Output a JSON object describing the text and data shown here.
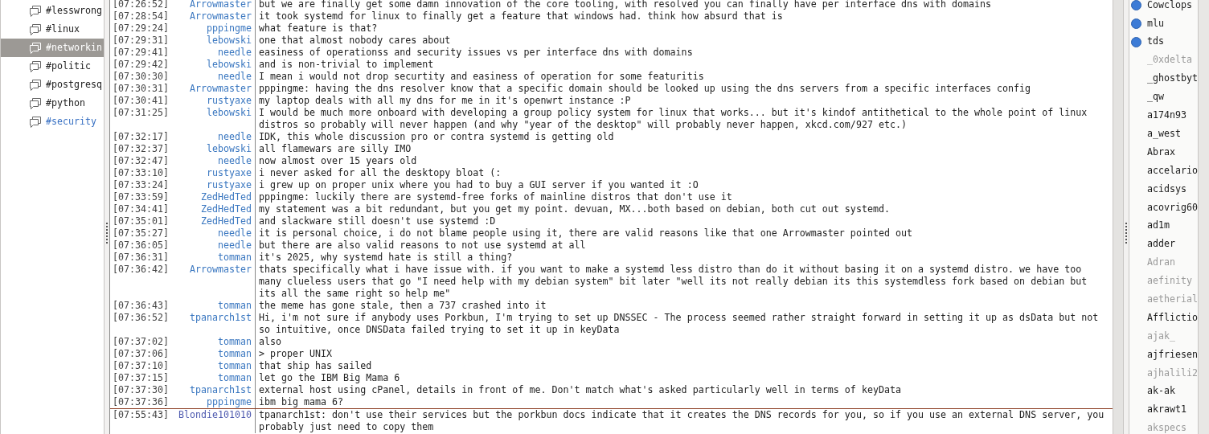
{
  "channels": [
    {
      "name": "#lesswrong",
      "selected": false,
      "new_activity": false
    },
    {
      "name": "#linux",
      "selected": false,
      "new_activity": false
    },
    {
      "name": "#networkin",
      "selected": true,
      "new_activity": false
    },
    {
      "name": "#politic",
      "selected": false,
      "new_activity": false
    },
    {
      "name": "#postgresq",
      "selected": false,
      "new_activity": false
    },
    {
      "name": "#python",
      "selected": false,
      "new_activity": false
    },
    {
      "name": "#security",
      "selected": false,
      "new_activity": true
    }
  ],
  "chat": {
    "messages": [
      {
        "time": "[07:26:52]",
        "nick": "Arrowmaster",
        "color": "#3a77c0",
        "text": "but we are finally get some damn innovation of the core tooling, with resolved you can finally have per interface dns with domains"
      },
      {
        "time": "[07:28:54]",
        "nick": "Arrowmaster",
        "color": "#3a77c0",
        "text": "it took systemd for linux to finally get a feature that windows had. think how absurd that is"
      },
      {
        "time": "[07:29:24]",
        "nick": "pppingme",
        "color": "#3a77c0",
        "text": "what feature is that?"
      },
      {
        "time": "[07:29:31]",
        "nick": "lebowski",
        "color": "#3a77c0",
        "text": "one that almost nobody cares about"
      },
      {
        "time": "[07:29:41]",
        "nick": "needle",
        "color": "#3a77c0",
        "text": "easiness of operationss and security issues vs per interface dns with domains"
      },
      {
        "time": "[07:29:42]",
        "nick": "lebowski",
        "color": "#3a77c0",
        "text": "and is non-trivial to implement"
      },
      {
        "time": "[07:30:30]",
        "nick": "needle",
        "color": "#3a77c0",
        "text": "I mean i would not drop securtity and easiness of operation for some featuritis"
      },
      {
        "time": "[07:30:31]",
        "nick": "Arrowmaster",
        "color": "#3a77c0",
        "text": "pppingme: having the dns resolver know that a specific domain should be looked up using the dns servers from a specific interfaces config"
      },
      {
        "time": "[07:30:41]",
        "nick": "rustyaxe",
        "color": "#3a77c0",
        "text": "my laptop deals with all my dns for me in it's openwrt instance :P"
      },
      {
        "time": "[07:31:25]",
        "nick": "lebowski",
        "color": "#3a77c0",
        "text": "I would be much more onboard with developing a group policy system for linux that works... but it's kindof antithetical to the whole point of linux distros so probably will never happen (and why \"year of the desktop\" will probably never happen, xkcd.com/927 etc.)"
      },
      {
        "time": "[07:32:17]",
        "nick": "needle",
        "color": "#3a77c0",
        "text": "IDK, this whole discussion pro or contra systemd is getting old"
      },
      {
        "time": "[07:32:37]",
        "nick": "lebowski",
        "color": "#3a77c0",
        "text": "all flamewars are silly IMO"
      },
      {
        "time": "[07:32:47]",
        "nick": "needle",
        "color": "#3a77c0",
        "text": "now almost over 15 years old"
      },
      {
        "time": "[07:33:10]",
        "nick": "rustyaxe",
        "color": "#3a77c0",
        "text": "i never asked for all the desktopy bloat (:"
      },
      {
        "time": "[07:33:24]",
        "nick": "rustyaxe",
        "color": "#3a77c0",
        "text": "i grew up on proper unix where you had to buy a GUI server if you wanted it :O"
      },
      {
        "time": "[07:33:59]",
        "nick": "ZedHedTed",
        "color": "#3a77c0",
        "text": "pppingme: luckily there are systemd-free forks of mainline distros that don't use it"
      },
      {
        "time": "[07:34:41]",
        "nick": "ZedHedTed",
        "color": "#3a77c0",
        "text": "my statement was a bit redundant, but you get my point. devuan, MX...both based on debian, both cut out systemd."
      },
      {
        "time": "[07:35:01]",
        "nick": "ZedHedTed",
        "color": "#3a77c0",
        "text": "and slackware still doesn't use systemd :D"
      },
      {
        "time": "[07:35:27]",
        "nick": "needle",
        "color": "#3a77c0",
        "text": "it is personal choice, i do not blame people using it, there are valid reasons like that one Arrowmaster pointed out"
      },
      {
        "time": "[07:36:05]",
        "nick": "needle",
        "color": "#3a77c0",
        "text": "but there are also valid reasons to not use systemd at all"
      },
      {
        "time": "[07:36:31]",
        "nick": "tomman",
        "color": "#3a77c0",
        "text": "it's 2025, why systemd hate is still a thing?"
      },
      {
        "time": "[07:36:42]",
        "nick": "Arrowmaster",
        "color": "#3a77c0",
        "text": "thats specifically what i have issue with. if you want to make a systemd less distro than do it without basing it on a systemd distro. we have too many clueless users that go \"I need help with my debian system\" bit later \"well its not really debian its this systemdless fork based on debian but its all the same right so help me\""
      },
      {
        "time": "[07:36:43]",
        "nick": "tomman",
        "color": "#3a77c0",
        "text": "the meme has gone stale, then a 737 crashed into it"
      },
      {
        "time": "[07:36:52]",
        "nick": "tpanarch1st",
        "color": "#3a77c0",
        "text": "Hi, i'm not sure if anybody uses Porkbun, I'm trying to set up DNSSEC - The process seemed rather straight forward in setting it up as dsData but not so intuitive, once DNSData failed trying to set it up in keyData"
      },
      {
        "time": "[07:37:02]",
        "nick": "tomman",
        "color": "#3a77c0",
        "text": "also"
      },
      {
        "time": "[07:37:06]",
        "nick": "tomman",
        "color": "#3a77c0",
        "text": "> proper UNIX"
      },
      {
        "time": "[07:37:10]",
        "nick": "tomman",
        "color": "#3a77c0",
        "text": "that ship has sailed"
      },
      {
        "time": "[07:37:15]",
        "nick": "tomman",
        "color": "#3a77c0",
        "text": "let go the IBM Big Mama 6"
      },
      {
        "time": "[07:37:30]",
        "nick": "tpanarch1st",
        "color": "#3a77c0",
        "text": "external host using cPanel, details in front of me. Don't match what's asked particularly well in terms of keyData"
      },
      {
        "time": "[07:37:36]",
        "nick": "pppingme",
        "color": "#3a77c0",
        "text": "ibm big mama 6?"
      }
    ],
    "new_messages": [
      {
        "time": "[07:55:43]",
        "nick": "Blondie101010",
        "color": "#4f5bb0",
        "text": "tpanarch1st: don't use their services but the porkbun docs indicate that it creates the DNS records for you, so if you use an external DNS server, you probably just need to copy them"
      }
    ]
  },
  "users": [
    {
      "name": "Cowclops",
      "op": true,
      "away": false
    },
    {
      "name": "mlu",
      "op": true,
      "away": false
    },
    {
      "name": "tds",
      "op": true,
      "away": false
    },
    {
      "name": "_0xdelta",
      "op": false,
      "away": true
    },
    {
      "name": "_ghostbyt",
      "op": false,
      "away": false
    },
    {
      "name": "_qw",
      "op": false,
      "away": false
    },
    {
      "name": "a174n93",
      "op": false,
      "away": false
    },
    {
      "name": "a_west",
      "op": false,
      "away": false
    },
    {
      "name": "Abrax",
      "op": false,
      "away": false
    },
    {
      "name": "accelario",
      "op": false,
      "away": false
    },
    {
      "name": "acidsys",
      "op": false,
      "away": false
    },
    {
      "name": "acovrig60",
      "op": false,
      "away": false
    },
    {
      "name": "ad1m",
      "op": false,
      "away": false
    },
    {
      "name": "adder",
      "op": false,
      "away": false
    },
    {
      "name": "Adran",
      "op": false,
      "away": true
    },
    {
      "name": "aefinity",
      "op": false,
      "away": true
    },
    {
      "name": "aetherial",
      "op": false,
      "away": true
    },
    {
      "name": "Afflictio",
      "op": false,
      "away": false
    },
    {
      "name": "ajak_",
      "op": false,
      "away": true
    },
    {
      "name": "ajfriesen",
      "op": false,
      "away": false
    },
    {
      "name": "ajhalili2",
      "op": false,
      "away": true
    },
    {
      "name": "ak-ak",
      "op": false,
      "away": false
    },
    {
      "name": "akrawt1",
      "op": false,
      "away": false
    },
    {
      "name": "akspecs",
      "op": false,
      "away": true
    }
  ]
}
